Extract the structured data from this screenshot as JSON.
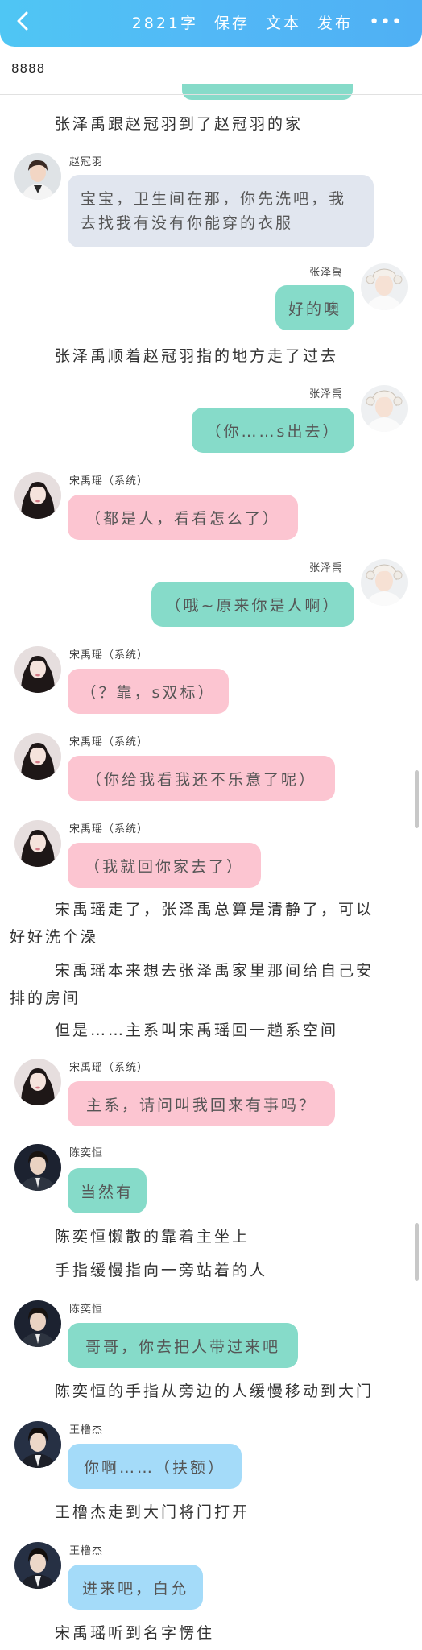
{
  "header": {
    "word_count": "2821字",
    "save": "保存",
    "text": "文本",
    "publish": "发布",
    "more": "•••"
  },
  "story_title": "8888",
  "narration": [
    "张泽禹跟赵冠羽到了赵冠羽的家",
    "张泽禹顺着赵冠羽指的地方走了过去",
    "宋禹瑶走了，张泽禹总算是清静了，可以",
    "好好洗个澡",
    "宋禹瑶本来想去张泽禹家里那间给自己安",
    "排的房间",
    "但是……主系叫宋禹瑶回一趟系空间",
    "陈奕恒懒散的靠着主坐上",
    "手指缓慢指向一旁站着的人",
    "陈奕恒的手指从旁边的人缓慢移动到大门",
    "王橹杰走到大门将门打开",
    "宋禹瑶听到名字愣住"
  ],
  "messages": [
    {
      "name": "赵冠羽",
      "text": "宝宝，卫生间在那，你先洗吧，我去找我有没有你能穿的衣服"
    },
    {
      "name": "张泽禹",
      "text": "好的噢"
    },
    {
      "name": "张泽禹",
      "text": "（你……s出去）"
    },
    {
      "name": "宋禹瑶（系统）",
      "text": "（都是人，看看怎么了）"
    },
    {
      "name": "张泽禹",
      "text": "（哦~原来你是人啊）"
    },
    {
      "name": "宋禹瑶（系统）",
      "text": "（？靠，s双标）"
    },
    {
      "name": "宋禹瑶（系统）",
      "text": "（你给我看我还不乐意了呢）"
    },
    {
      "name": "宋禹瑶（系统）",
      "text": "（我就回你家去了）"
    },
    {
      "name": "宋禹瑶（系统）",
      "text": "主系，请问叫我回来有事吗？"
    },
    {
      "name": "陈奕恒",
      "text": "当然有"
    },
    {
      "name": "陈奕恒",
      "text": "哥哥，你去把人带过来吧"
    },
    {
      "name": "王橹杰",
      "text": "你啊……（扶额）"
    },
    {
      "name": "王橹杰",
      "text": "进来吧，白允"
    }
  ],
  "colors": {
    "header": "#52b8f6",
    "bubble_grey": "#e1e6ef",
    "bubble_green": "#86dbc9",
    "bubble_pink": "#fcc5d1",
    "bubble_blue": "#a4dbf9"
  }
}
